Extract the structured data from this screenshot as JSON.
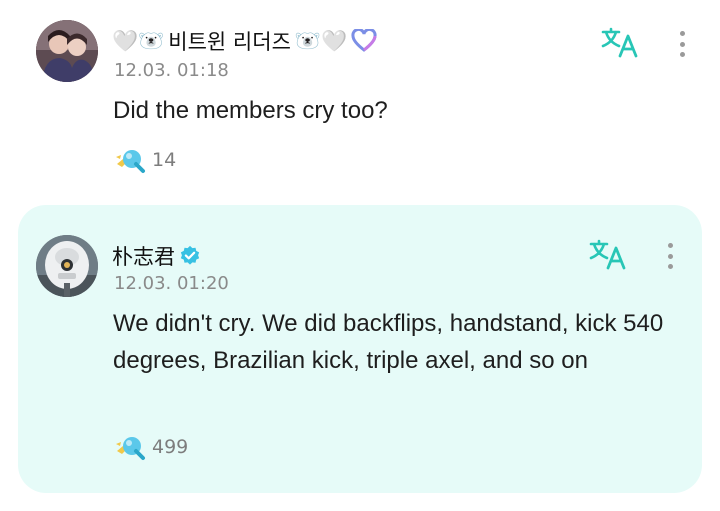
{
  "comments": [
    {
      "author": "비트윈 리더즈",
      "author_decor_left": "🤍🐻‍❄️",
      "author_decor_right": "🐻‍❄️🤍",
      "timestamp": "12.03. 01:18",
      "text": "Did the members cry too?",
      "likes": "14",
      "verified": false
    },
    {
      "author": "朴志君",
      "timestamp": "12.03. 01:20",
      "text": "We didn't cry. We did backflips, handstand, kick 540 degrees, Brazilian kick, triple axel, and so on",
      "likes": "499",
      "verified": true,
      "highlighted": true
    }
  ],
  "icons": {
    "translate": "translate-icon",
    "more": "more-vertical-icon",
    "like": "like-icon",
    "verified": "verified-badge-icon",
    "heart": "heart-icon"
  },
  "colors": {
    "accent": "#28c6b6",
    "highlight_bg": "#e6fbf8",
    "verified": "#37c1e3",
    "timestamp": "#8a8a8a"
  }
}
